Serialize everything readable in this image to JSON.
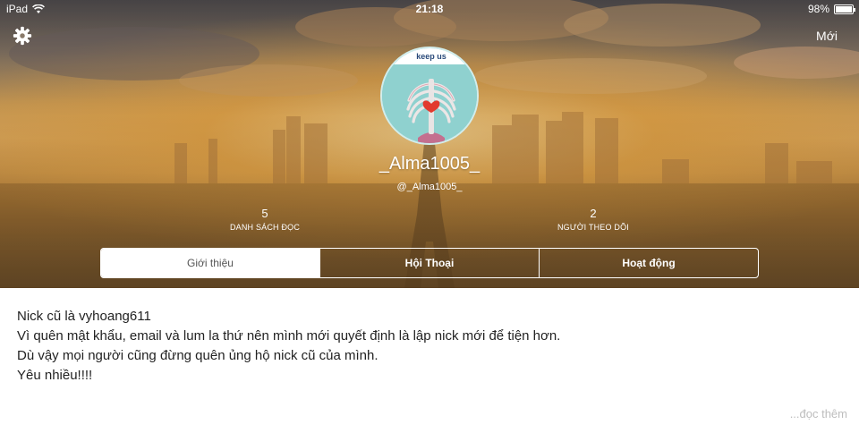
{
  "statusbar": {
    "device": "iPad",
    "time": "21:18",
    "battery": "98%",
    "battery_level": 0.98
  },
  "header": {
    "new_label": "Mới"
  },
  "profile": {
    "display_name": "_Alma1005_",
    "handle": "@_Alma1005_",
    "avatar_text": "keep us"
  },
  "stats": {
    "reading_lists": {
      "count": "5",
      "label": "DANH SÁCH ĐỌC"
    },
    "followers": {
      "count": "2",
      "label": "NGƯỜI THEO DÕI"
    }
  },
  "tabs": [
    {
      "label": "Giới thiệu"
    },
    {
      "label": "Hội Thoại"
    },
    {
      "label": "Hoạt động"
    }
  ],
  "bio": {
    "lines": [
      "Nick cũ là vyhoang611",
      "Vì quên mật khẩu, email và lum la thứ nên mình mới quyết định là lập nick mới để tiện hơn.",
      "Dù vậy mọi người cũng đừng quên ủng hộ nick cũ của mình.",
      "Yêu nhiều!!!!"
    ],
    "read_more": "...đọc thêm"
  },
  "colors": {
    "active_tab_bg": "#ffffff",
    "accent_text": "#ffffff",
    "body_text": "#222222",
    "muted_text": "#bdbdbd"
  }
}
